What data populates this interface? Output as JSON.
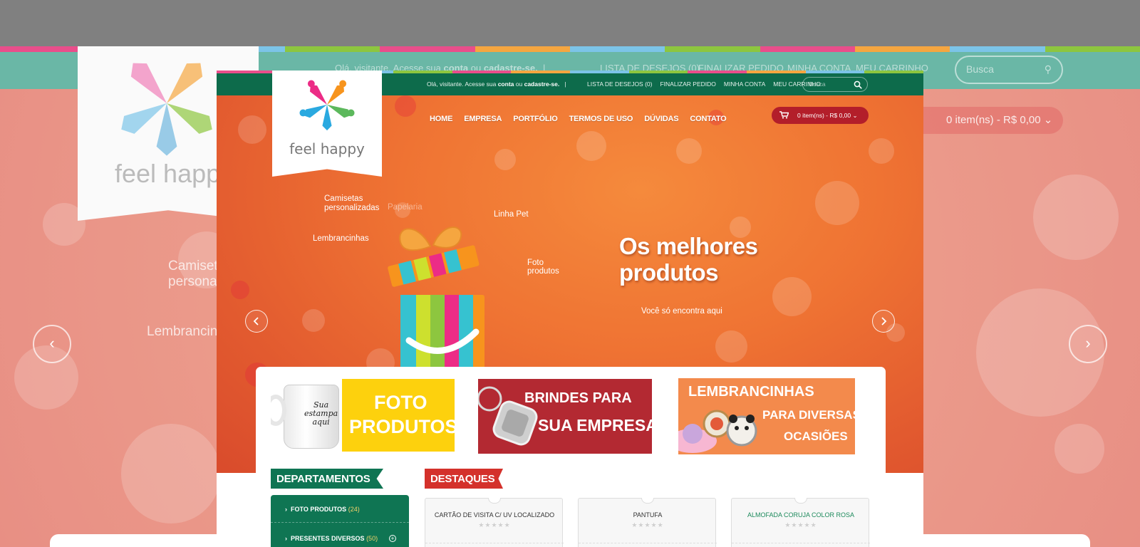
{
  "colors": {
    "green": "#0d6b4b",
    "orange": "#ef7333",
    "red": "#b31e2a",
    "stripes": [
      "#e94e8b",
      "#f5a640",
      "#7cc4e8",
      "#8dc63f",
      "#e94e8b",
      "#f5a640",
      "#7cc4e8",
      "#8dc63f",
      "#e94e8b",
      "#f5a640",
      "#7cc4e8",
      "#8dc63f"
    ]
  },
  "background": {
    "greeting": "Olá, visitante. Acesse sua",
    "greeting_conta": "conta",
    "greeting_or": "ou",
    "greeting_cadastre": "cadastre-se.",
    "links": [
      "LISTA DE DESEJOS (0)",
      "FINALIZAR PEDIDO",
      "MINHA CONTA",
      "MEU CARRINHO"
    ],
    "search_placeholder": "Busca",
    "cart": "0 item(ns) - R$ 0,00",
    "logo_text": "feel happy",
    "label_camiseta": "Camiseta",
    "label_persona": "persona",
    "label_lembrancin": "Lembrancin"
  },
  "topbar": {
    "greeting_prefix": "Olá, visitante. Acesse sua",
    "login_link": "conta",
    "or": "ou",
    "register_link": "cadastre-se.",
    "separator": "|",
    "links": [
      "LISTA DE DESEJOS (0)",
      "FINALIZAR PEDIDO",
      "MINHA CONTA",
      "MEU CARRINHO"
    ],
    "search_placeholder": "Busca"
  },
  "logo": {
    "text": "feel happy"
  },
  "nav": {
    "items": [
      "HOME",
      "EMPRESA",
      "PORTFÓLIO",
      "TERMOS DE USO",
      "DÚVIDAS",
      "CONTATO"
    ]
  },
  "cart": {
    "label": "0 item(ns) - R$ 0,00"
  },
  "hero": {
    "label_camisetas": "Camisetas",
    "label_personalizadas": "personalizadas",
    "label_papelaria": "Papelaria",
    "label_lembrancinhas": "Lembrancinhas",
    "label_linha_pet": "Linha Pet",
    "label_foto": "Foto",
    "label_produtos": "produtos",
    "headline_line1": "Os melhores",
    "headline_line2": "produtos",
    "subtitle": "Você só encontra aqui"
  },
  "banners": {
    "foto": {
      "line1": "FOTO",
      "line2": "PRODUTOS",
      "mug_line1": "Sua",
      "mug_line2": "estampa",
      "mug_line3": "aqui"
    },
    "brindes": {
      "line1": "BRINDES PARA",
      "line2": "SUA EMPRESA"
    },
    "lembrancinhas": {
      "line1": "LEMBRANCINHAS",
      "line2": "PARA DIVERSAS",
      "line3": "OCASIÕES"
    }
  },
  "departments": {
    "title": "DEPARTAMENTOS",
    "items": [
      {
        "label": "FOTO PRODUTOS",
        "count": "(24)"
      },
      {
        "label": "PRESENTES DIVERSOS",
        "count": "(50)"
      }
    ]
  },
  "featured": {
    "title": "DESTAQUES",
    "products": [
      {
        "name": "CARTÃO DE VISITA C/ UV LOCALIZADO",
        "stars": "★★★★★"
      },
      {
        "name": "PANTUFA",
        "stars": "★★★★★"
      },
      {
        "name": "ALMOFADA CORUJA COLOR ROSA",
        "stars": "★★★★★"
      }
    ]
  }
}
